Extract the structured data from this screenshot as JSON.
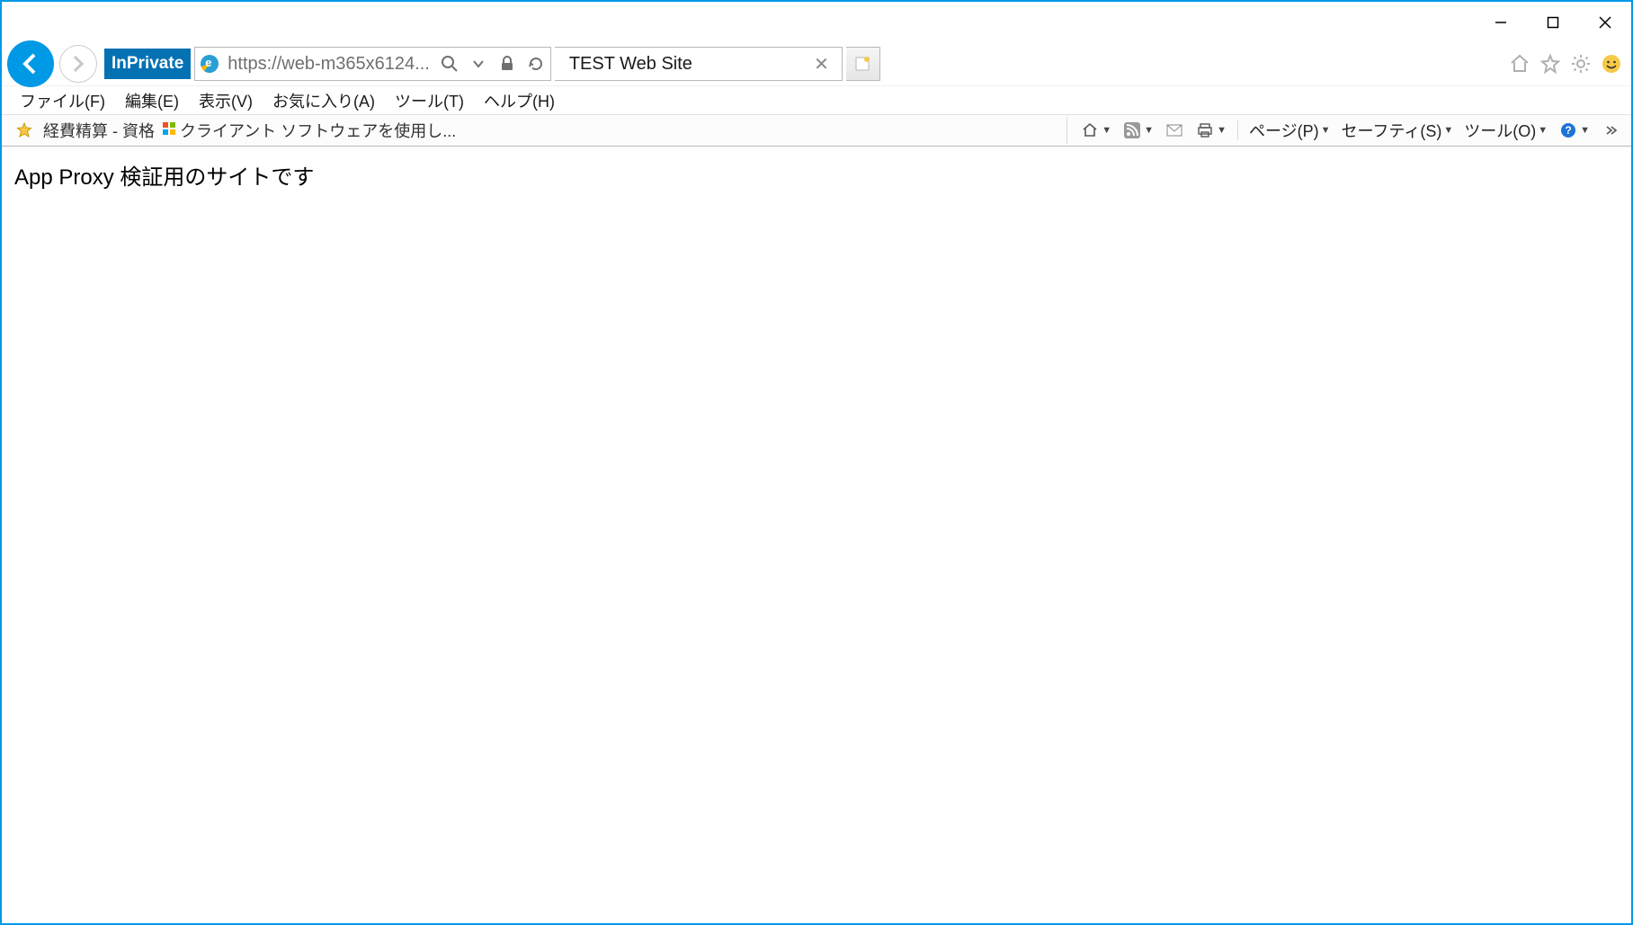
{
  "window": {
    "inprivate_label": "InPrivate"
  },
  "address": {
    "url_display": "https://web-m365x6124..."
  },
  "tab": {
    "title": "TEST Web Site"
  },
  "menubar": {
    "file": "ファイル(F)",
    "edit": "編集(E)",
    "view": "表示(V)",
    "favorites": "お気に入り(A)",
    "tools": "ツール(T)",
    "help": "ヘルプ(H)"
  },
  "favbar": {
    "item1": "経費精算 - 資格",
    "item2": "クライアント ソフトウェアを使用し..."
  },
  "cmdbar": {
    "page": "ページ(P)",
    "safety": "セーフティ(S)",
    "tools": "ツール(O)"
  },
  "content": {
    "heading": "App Proxy 検証用のサイトです"
  }
}
